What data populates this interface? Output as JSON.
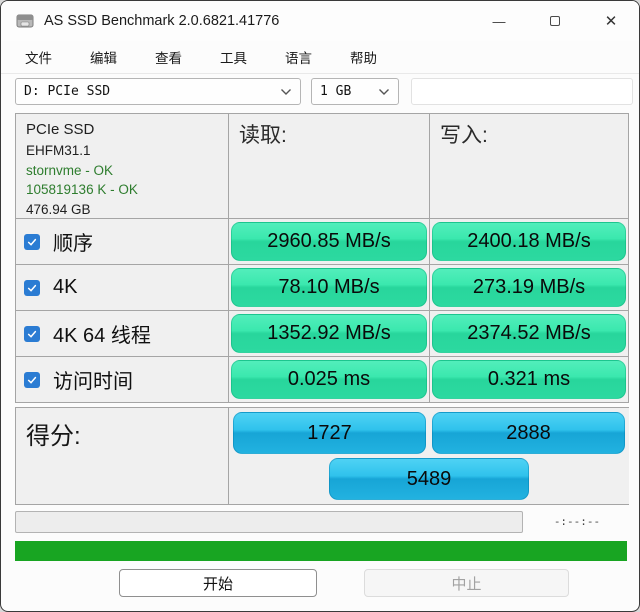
{
  "window": {
    "title": "AS SSD Benchmark 2.0.6821.41776"
  },
  "titlebar_icons": {
    "minimize": "—",
    "close": "✕"
  },
  "menu": {
    "items": [
      "文件",
      "编辑",
      "查看",
      "工具",
      "语言",
      "帮助"
    ]
  },
  "toolbar": {
    "drive_value": "D: PCIe SSD",
    "test_size_value": "1 GB",
    "extra_field_value": ""
  },
  "drive_info": {
    "name": "PCIe SSD",
    "firmware": "EHFM31.1",
    "driver": "stornvme - OK",
    "offset": "105819136 K - OK",
    "capacity": "476.94 GB"
  },
  "headers": {
    "read": "读取:",
    "write": "写入:"
  },
  "tests": [
    {
      "label": "顺序",
      "checked": true,
      "read": "2960.85 MB/s",
      "write": "2400.18 MB/s"
    },
    {
      "label": "4K",
      "checked": true,
      "read": "78.10 MB/s",
      "write": "273.19 MB/s"
    },
    {
      "label": "4K 64 线程",
      "checked": true,
      "read": "1352.92 MB/s",
      "write": "2374.52 MB/s"
    },
    {
      "label": "访问时间",
      "checked": true,
      "read": "0.025 ms",
      "write": "0.321 ms"
    }
  ],
  "score": {
    "label": "得分:",
    "read": "1727",
    "write": "2888",
    "total": "5489"
  },
  "status": {
    "elapsed_time": "-:--:--"
  },
  "buttons": {
    "start": "开始",
    "abort": "中止"
  },
  "colors": {
    "value_pill_green_top": "#3de9b0",
    "value_pill_green_bottom": "#2bd69c",
    "score_pill_blue_top": "#44ccf2",
    "score_pill_blue_bottom": "#1caade",
    "checkbox_accent": "#2b7cd3",
    "progress_green": "#18a522",
    "info_ok_green": "#2e7d2e"
  }
}
